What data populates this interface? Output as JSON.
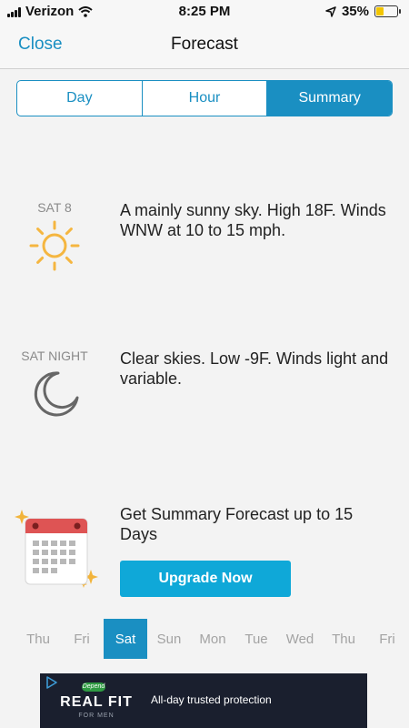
{
  "status_bar": {
    "carrier": "Verizon",
    "time": "8:25 PM",
    "battery": "35%",
    "battery_level": 0.35
  },
  "nav": {
    "close_label": "Close",
    "title": "Forecast"
  },
  "tabs": [
    {
      "label": "Day",
      "active": false
    },
    {
      "label": "Hour",
      "active": false
    },
    {
      "label": "Summary",
      "active": true
    }
  ],
  "forecasts": [
    {
      "day": "SAT 8",
      "icon": "sun-icon",
      "text": "A mainly sunny sky. High 18F. Winds WNW at 10 to 15 mph."
    },
    {
      "day": "SAT NIGHT",
      "icon": "moon-icon",
      "text": "Clear skies. Low -9F. Winds light and variable."
    }
  ],
  "promo": {
    "text": "Get Summary Forecast up to 15 Days",
    "button_label": "Upgrade Now",
    "icon": "calendar-icon"
  },
  "days": [
    {
      "label": "Thu",
      "active": false
    },
    {
      "label": "Fri",
      "active": false
    },
    {
      "label": "Sat",
      "active": true
    },
    {
      "label": "Sun",
      "active": false
    },
    {
      "label": "Mon",
      "active": false
    },
    {
      "label": "Tue",
      "active": false
    },
    {
      "label": "Wed",
      "active": false
    },
    {
      "label": "Thu",
      "active": false
    },
    {
      "label": "Fri",
      "active": false
    }
  ],
  "ad": {
    "badge": "Depend",
    "brand": "REAL FIT",
    "sub": "FOR MEN",
    "tagline": "All-day trusted protection"
  },
  "colors": {
    "accent": "#1a8fc2",
    "button": "#0fa8d8",
    "sun": "#f5b640",
    "moon": "#666666",
    "calendar_header": "#de5454",
    "sparkle": "#f2b43b"
  }
}
